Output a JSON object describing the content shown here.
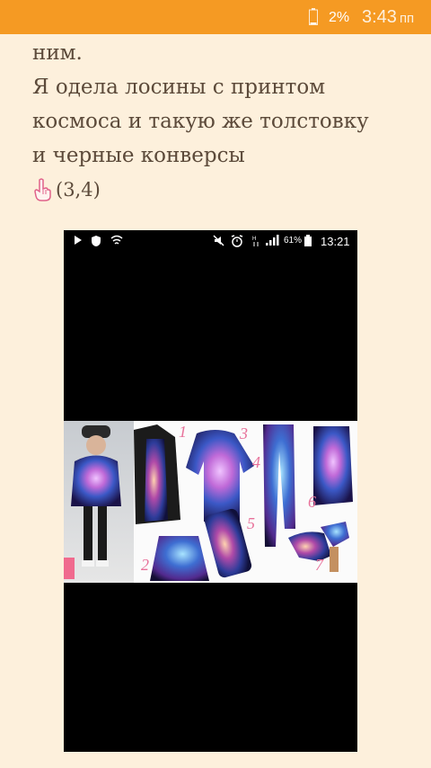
{
  "status_bar": {
    "battery_percent": "2%",
    "time": "3:43",
    "time_suffix": "пп",
    "background_color": "#f59a23"
  },
  "article": {
    "lines": [
      "ним.",
      "Я одела лосины с принтом",
      "космоса и такую же толстовку",
      "и черные конверсы"
    ],
    "rating_icon": "pointing-hand-icon",
    "rating_text": "(3,4)"
  },
  "embedded_screenshot": {
    "status_bar": {
      "battery_percent": "61%",
      "time": "13:21"
    },
    "collage": {
      "description_numbers": [
        "1",
        "2",
        "3",
        "4",
        "5",
        "6",
        "7"
      ]
    }
  }
}
